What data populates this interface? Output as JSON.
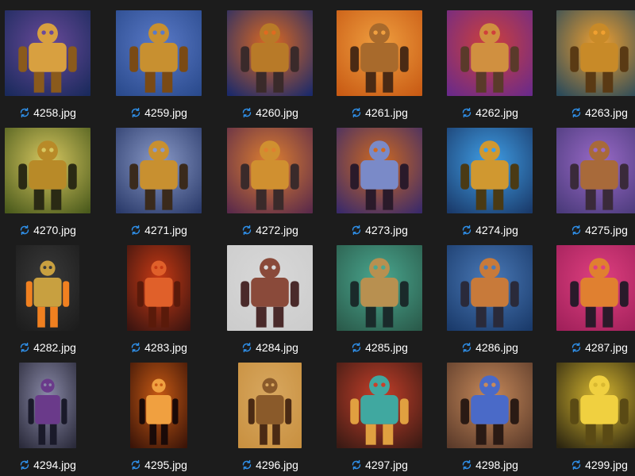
{
  "icon": "sync-icon",
  "colors": {
    "background": "#1c1c1c",
    "label": "#ffffff",
    "sync_icon": "#2f8fe8"
  },
  "files": [
    {
      "name": "4258.jpg",
      "palette": [
        "#1a2a5c",
        "#6a4a9a",
        "#d8a040",
        "#8a5a1c"
      ]
    },
    {
      "name": "4259.jpg",
      "palette": [
        "#2a4a8c",
        "#5a7ac8",
        "#c89030",
        "#7a4a14"
      ]
    },
    {
      "name": "4260.jpg",
      "palette": [
        "#1c2a6a",
        "#e06a20",
        "#b87a28",
        "#3a2a2a"
      ]
    },
    {
      "name": "4261.jpg",
      "palette": [
        "#c85a14",
        "#f0a040",
        "#a86a2c",
        "#4a2a14"
      ]
    },
    {
      "name": "4262.jpg",
      "palette": [
        "#6a2a8a",
        "#d0403a",
        "#d09040",
        "#5a3a2a"
      ]
    },
    {
      "name": "4263.jpg",
      "palette": [
        "#2a4a5a",
        "#f0a030",
        "#c88a28",
        "#5a3a14"
      ]
    },
    {
      "name": "4270.jpg",
      "palette": [
        "#4a5a1c",
        "#d8c860",
        "#b88a28",
        "#2a2a14"
      ]
    },
    {
      "name": "4271.jpg",
      "palette": [
        "#2a3a6a",
        "#8a9ac8",
        "#c89030",
        "#3a2a1c"
      ]
    },
    {
      "name": "4272.jpg",
      "palette": [
        "#5a2a4a",
        "#e08030",
        "#d09030",
        "#3a2a2a"
      ]
    },
    {
      "name": "4273.jpg",
      "palette": [
        "#3a2a6a",
        "#d06a20",
        "#7a8ac8",
        "#2a1a2a"
      ]
    },
    {
      "name": "4274.jpg",
      "palette": [
        "#1a3a6a",
        "#40a0e8",
        "#d09830",
        "#4a3a14"
      ]
    },
    {
      "name": "4275.jpg",
      "palette": [
        "#4a3a7a",
        "#9a6ac8",
        "#a86a3a",
        "#3a2a3a"
      ]
    },
    {
      "name": "4282.jpg",
      "palette": [
        "#1c1c1c",
        "#3a3a3a",
        "#c8a040",
        "#f08020"
      ]
    },
    {
      "name": "4283.jpg",
      "palette": [
        "#3a1410",
        "#c83a14",
        "#e0602a",
        "#5a1a0a"
      ]
    },
    {
      "name": "4284.jpg",
      "palette": [
        "#cccccc",
        "#d8d8d8",
        "#8a4a3a",
        "#4a2a2a"
      ]
    },
    {
      "name": "4285.jpg",
      "palette": [
        "#2a5a4a",
        "#4aa890",
        "#b89050",
        "#1a2a2a"
      ]
    },
    {
      "name": "4286.jpg",
      "palette": [
        "#1a3a6a",
        "#4a7ab8",
        "#c87a3a",
        "#2a2a3a"
      ]
    },
    {
      "name": "4287.jpg",
      "palette": [
        "#a0205a",
        "#e04080",
        "#e08030",
        "#2a1a2a"
      ]
    },
    {
      "name": "4294.jpg",
      "palette": [
        "#2a2a3a",
        "#8a8aa8",
        "#6a3a8a",
        "#1a1a2a"
      ]
    },
    {
      "name": "4295.jpg",
      "palette": [
        "#3a1408",
        "#c85a14",
        "#f0a040",
        "#1a0a08"
      ]
    },
    {
      "name": "4296.jpg",
      "palette": [
        "#c89040",
        "#d8a860",
        "#8a5a2a",
        "#4a2a14"
      ]
    },
    {
      "name": "4297.jpg",
      "palette": [
        "#3a1a14",
        "#c8402a",
        "#40a8a0",
        "#e0a040"
      ]
    },
    {
      "name": "4298.jpg",
      "palette": [
        "#5a3a2a",
        "#c88a5a",
        "#4a6ac8",
        "#2a1a14"
      ]
    },
    {
      "name": "4299.jpg",
      "palette": [
        "#2a2410",
        "#d8b830",
        "#f0d040",
        "#5a4a14"
      ]
    }
  ]
}
